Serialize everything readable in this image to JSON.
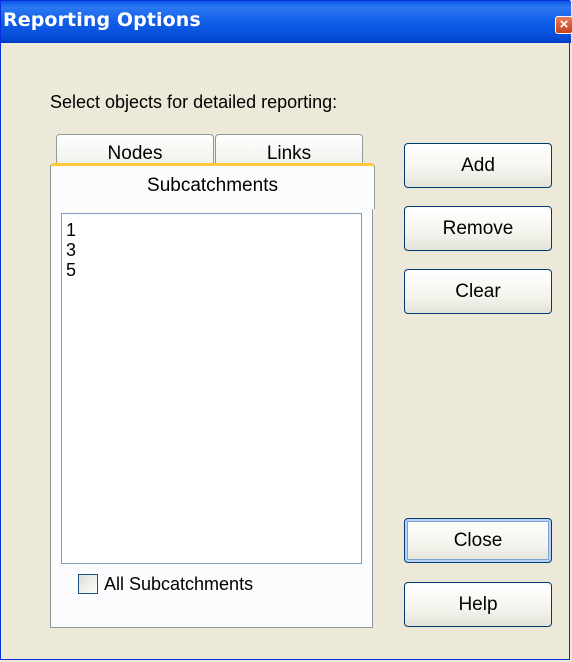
{
  "window": {
    "title": "Reporting Options",
    "close_glyph": "×"
  },
  "instructions": "Select objects for detailed reporting:",
  "tabs": [
    {
      "label": "Nodes",
      "active": false
    },
    {
      "label": "Links",
      "active": false
    },
    {
      "label": "Subcatchments",
      "active": true
    }
  ],
  "list": {
    "items": [
      "1",
      "3",
      "5"
    ]
  },
  "all_checkbox": {
    "label": "All Subcatchments",
    "checked": false
  },
  "buttons": {
    "add": "Add",
    "remove": "Remove",
    "clear": "Clear",
    "close": "Close",
    "help": "Help"
  },
  "colors": {
    "titlebar": "#0A58EA",
    "dialog_bg": "#ECE9D8",
    "active_tab_accent": "#FFC83C",
    "button_border": "#003C74"
  },
  "icons": {
    "close": "close-icon"
  }
}
